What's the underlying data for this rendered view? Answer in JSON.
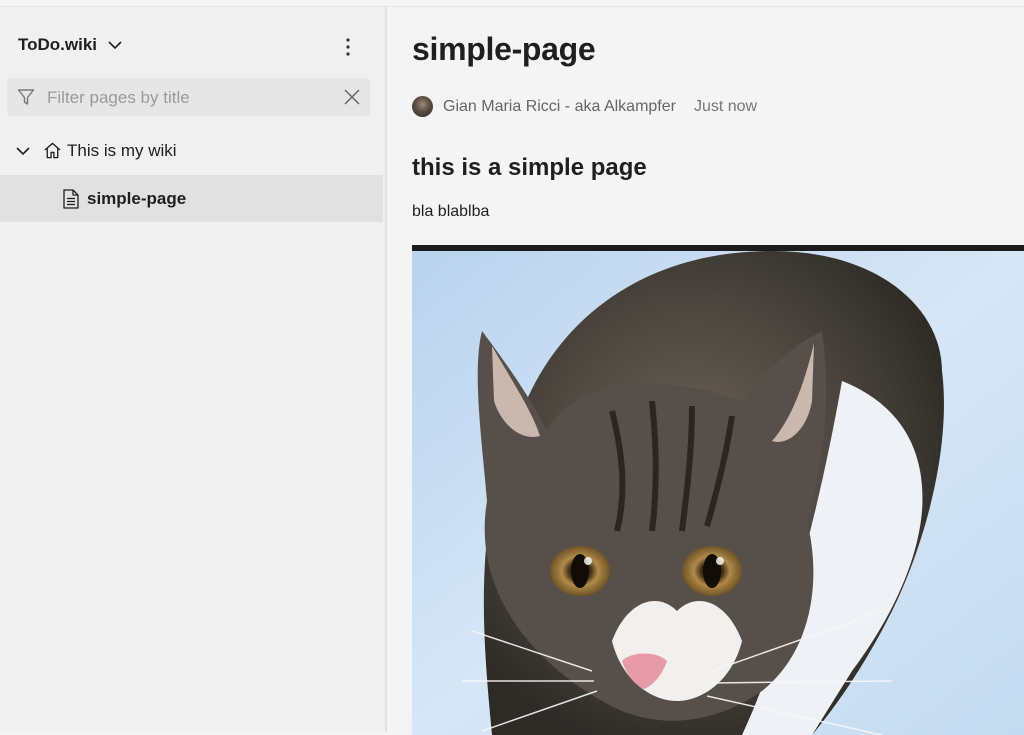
{
  "sidebar": {
    "wiki_title": "ToDo.wiki",
    "filter_placeholder": "Filter pages by title",
    "filter_value": "",
    "tree": {
      "root_label": "This is my wiki",
      "child_label": "simple-page"
    }
  },
  "page": {
    "title": "simple-page",
    "author": "Gian Maria Ricci - aka Alkampfer",
    "timestamp": "Just now",
    "heading": "this is a simple page",
    "body_text": "bla blablba",
    "image_subject": "tabby cat in snow"
  },
  "icons": [
    "chevron-down-icon",
    "more-vertical-icon",
    "filter-icon",
    "clear-icon",
    "home-icon",
    "document-icon",
    "avatar"
  ],
  "colors": {
    "sidebar_bg": "#f0f0f0",
    "selected_bg": "#e1e1e1",
    "main_bg": "#f4f4f4",
    "text": "#201f1e",
    "muted": "#666666"
  }
}
